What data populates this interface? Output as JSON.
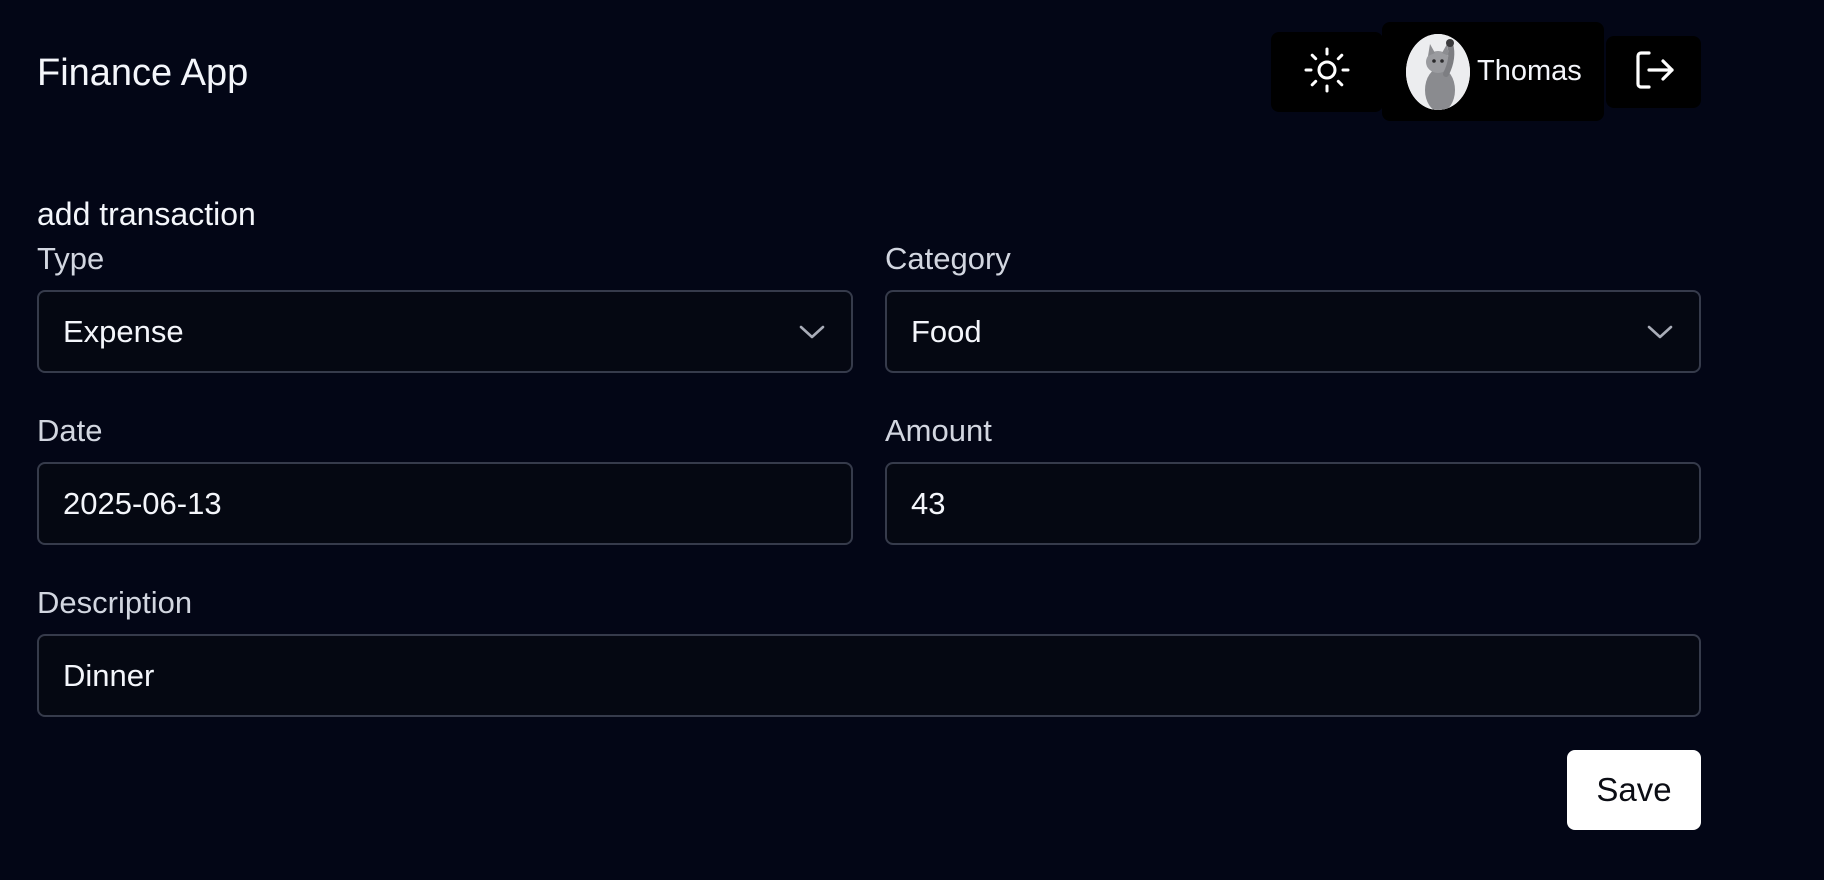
{
  "header": {
    "app_title": "Finance App",
    "theme_icon": "sun-icon",
    "user_name": "Thomas",
    "avatar_description": "cat",
    "logout_icon": "logout-icon"
  },
  "form": {
    "title": "add transaction",
    "type": {
      "label": "Type",
      "value": "Expense"
    },
    "category": {
      "label": "Category",
      "value": "Food"
    },
    "date": {
      "label": "Date",
      "value": "2025-06-13"
    },
    "amount": {
      "label": "Amount",
      "value": "43"
    },
    "description": {
      "label": "Description",
      "value": "Dinner"
    },
    "save_label": "Save"
  },
  "colors": {
    "background": "#030616",
    "field_border": "#363b4b",
    "button_primary": "#ffffff",
    "header_button_bg": "#000000"
  }
}
